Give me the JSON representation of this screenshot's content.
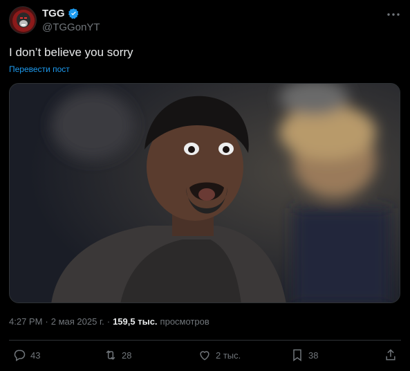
{
  "author": {
    "display_name": "TGG",
    "handle": "@TGGonYT",
    "verified": true
  },
  "tweet": {
    "text": "I don’t believe you sorry",
    "translate_label": "Перевести пост"
  },
  "meta": {
    "time": "4:27 PM",
    "sep1": "·",
    "date": "2 мая 2025 г.",
    "sep2": "·",
    "views_count": "159,5 тыс.",
    "views_label": "просмотров"
  },
  "actions": {
    "replies": "43",
    "reposts": "28",
    "likes": "2 тыс.",
    "bookmarks": "38"
  },
  "colors": {
    "accent": "#1d9bf0",
    "muted": "#71767b",
    "text": "#e7e9ea"
  }
}
